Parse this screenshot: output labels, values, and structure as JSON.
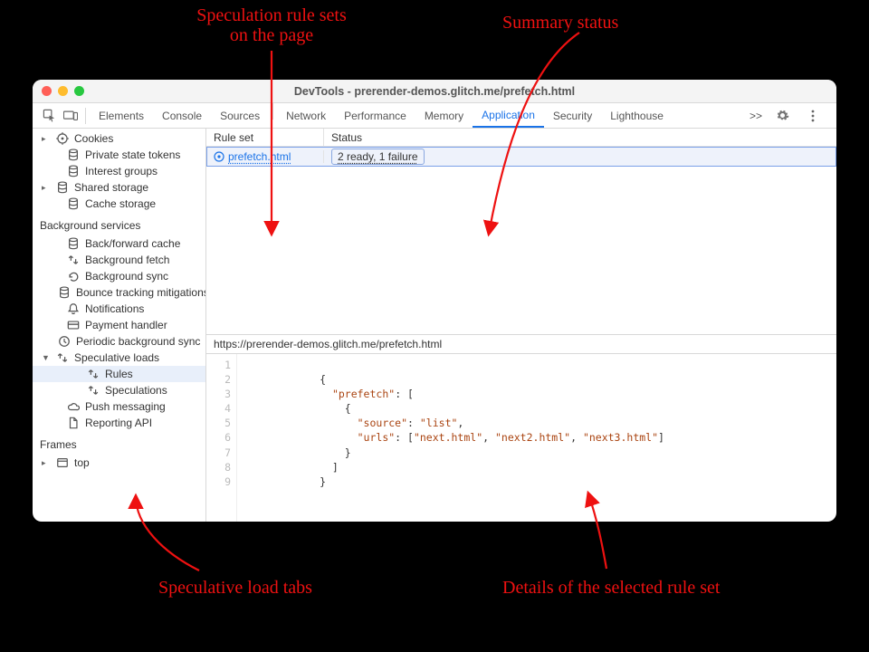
{
  "annotations": {
    "rule_sets": "Speculation rule sets\non the page",
    "summary": "Summary status",
    "tabs": "Speculative load tabs",
    "details": "Details of the selected rule set"
  },
  "window": {
    "title": "DevTools - prerender-demos.glitch.me/prefetch.html"
  },
  "tabs": {
    "items": [
      "Elements",
      "Console",
      "Sources",
      "Network",
      "Performance",
      "Memory",
      "Application",
      "Security",
      "Lighthouse"
    ],
    "active": "Application",
    "more": ">>"
  },
  "sidebar": {
    "app_items": [
      {
        "label": "Cookies",
        "icon": "target",
        "tw": "▸"
      },
      {
        "label": "Private state tokens",
        "icon": "db"
      },
      {
        "label": "Interest groups",
        "icon": "db"
      },
      {
        "label": "Shared storage",
        "icon": "db",
        "tw": "▸"
      },
      {
        "label": "Cache storage",
        "icon": "db"
      }
    ],
    "bg_header": "Background services",
    "bg_items": [
      {
        "label": "Back/forward cache",
        "icon": "db"
      },
      {
        "label": "Background fetch",
        "icon": "ud"
      },
      {
        "label": "Background sync",
        "icon": "sync"
      },
      {
        "label": "Bounce tracking mitigations",
        "icon": "db"
      },
      {
        "label": "Notifications",
        "icon": "bell"
      },
      {
        "label": "Payment handler",
        "icon": "card"
      },
      {
        "label": "Periodic background sync",
        "icon": "clock"
      },
      {
        "label": "Speculative loads",
        "icon": "ud",
        "tw": "▼",
        "exp": true
      },
      {
        "label": "Rules",
        "icon": "ud",
        "indent": 2,
        "sel": true
      },
      {
        "label": "Speculations",
        "icon": "ud",
        "indent": 2
      },
      {
        "label": "Push messaging",
        "icon": "cloud"
      },
      {
        "label": "Reporting API",
        "icon": "doc"
      }
    ],
    "frames_header": "Frames",
    "frames": [
      {
        "label": "top",
        "icon": "frame",
        "tw": "▸"
      }
    ]
  },
  "table": {
    "cols": {
      "rule": "Rule set",
      "status": "Status"
    },
    "rows": [
      {
        "rule": "prefetch.html",
        "status": "2 ready, 1 failure"
      }
    ]
  },
  "detail": {
    "url": "https://prerender-demos.glitch.me/prefetch.html",
    "code": [
      "",
      "{",
      "  \"prefetch\": [",
      "    {",
      "      \"source\": \"list\",",
      "      \"urls\": [\"next.html\", \"next2.html\", \"next3.html\"]",
      "    }",
      "  ]",
      "}"
    ]
  }
}
